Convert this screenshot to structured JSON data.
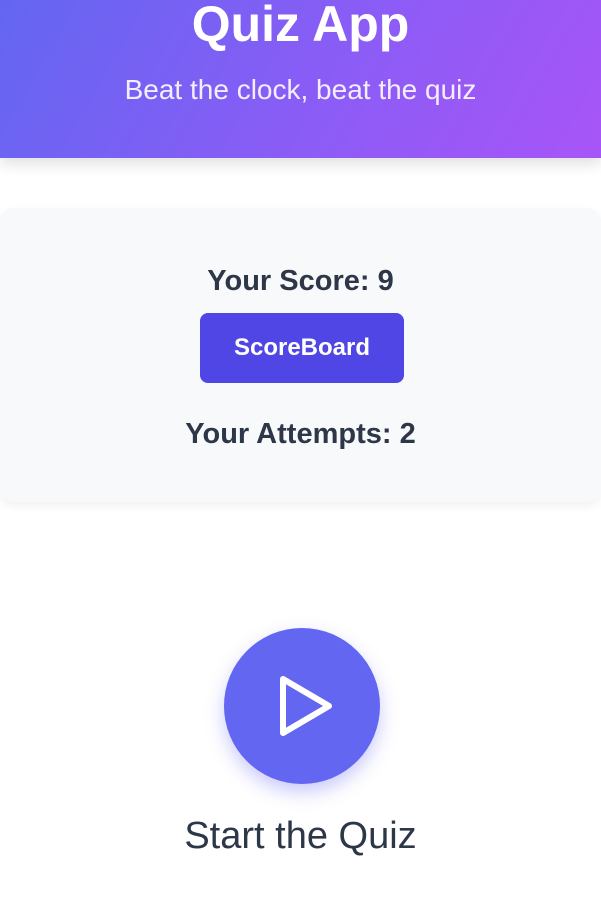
{
  "header": {
    "title": "Quiz App",
    "subtitle": "Beat the clock, beat the quiz"
  },
  "score_card": {
    "score_text": "Your Score: 9",
    "scoreboard_label": "ScoreBoard",
    "attempts_text": "Your Attempts: 2"
  },
  "start": {
    "icon": "play-icon",
    "label": "Start the Quiz"
  },
  "colors": {
    "header_gradient_start": "#6366f1",
    "header_gradient_end": "#a855f7",
    "button": "#4f46e5",
    "play_button": "#6366f1",
    "text_dark": "#2d3748"
  }
}
